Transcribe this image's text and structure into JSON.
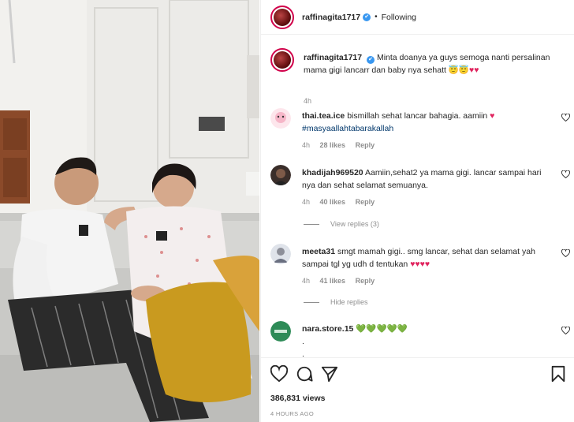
{
  "post": {
    "username": "raffinagita1717",
    "verified": "✔",
    "separator": "•",
    "follow_status": "Following",
    "caption_text": "Minta doanya ya guys semoga nanti persalinan mama gigi lancarr dan baby nya sehatt",
    "caption_emoji": "😇😇♥♥",
    "caption_time": "4h",
    "views": "386,831 views",
    "posted_ago": "4 HOURS AGO"
  },
  "comments": [
    {
      "username": "thai.tea.ice",
      "text": "bismillah sehat lancar bahagia. aamiin",
      "emoji": "♥",
      "hashtag": "#masyaallahtabarakallah",
      "time": "4h",
      "likes": "28 likes",
      "reply": "Reply",
      "like_icon": "heart-outline-icon"
    },
    {
      "username": "khadijah969520",
      "text": "Aamiin,sehat2 ya mama gigi. lancar sampai hari nya dan sehat selamat semuanya.",
      "time": "4h",
      "likes": "40 likes",
      "reply": "Reply",
      "view_replies": "View replies (3)",
      "like_icon": "heart-outline-icon"
    },
    {
      "username": "meeta31",
      "text": "smgt mamah gigi.. smg lancar, sehat dan selamat yah sampai tgl yg udh d tentukan",
      "emoji": "♥♥♥♥",
      "time": "4h",
      "likes": "41 likes",
      "reply": "Reply",
      "hide_replies": "Hide replies",
      "like_icon": "heart-outline-icon"
    },
    {
      "username": "nara.store.15",
      "emoji": "💚💚💚💚💚",
      "line2": ".",
      "line3": ".",
      "like_icon": "heart-outline-icon"
    }
  ],
  "actions": {
    "like": "heart-outline-icon",
    "comment": "comment-bubble-icon",
    "share": "paper-plane-icon",
    "save": "bookmark-icon"
  },
  "colors": {
    "verified_blue": "#3897f0",
    "heart_red": "#e0245e",
    "hashtag": "#00376b",
    "muted": "#8e8e8e"
  }
}
